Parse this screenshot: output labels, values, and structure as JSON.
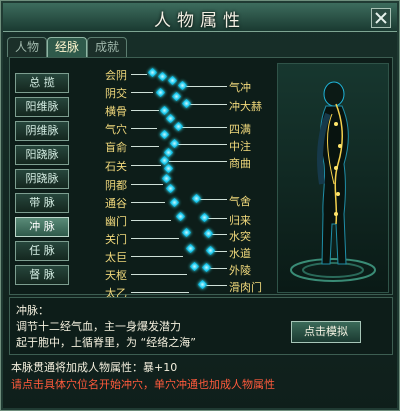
{
  "window": {
    "title": "人物属性"
  },
  "tabs": [
    {
      "label": "人物"
    },
    {
      "label": "经脉"
    },
    {
      "label": "成就"
    }
  ],
  "meridians": [
    {
      "label": "总 揽"
    },
    {
      "label": "阳维脉"
    },
    {
      "label": "阴维脉"
    },
    {
      "label": "阳跷脉"
    },
    {
      "label": "阴跷脉"
    },
    {
      "label": "带 脉"
    },
    {
      "label": "冲 脉"
    },
    {
      "label": "任 脉"
    },
    {
      "label": "督 脉"
    }
  ],
  "acupoints": {
    "left": [
      "会阴",
      "阴交",
      "横骨",
      "气穴",
      "盲俞",
      "石关",
      "阴都",
      "通谷",
      "幽门",
      "关门",
      "太巨",
      "天枢",
      "太乙"
    ],
    "right": [
      "气冲",
      "冲大赫",
      "四满",
      "中注",
      "商曲",
      "气舍",
      "归来",
      "水突",
      "水道",
      "外陵",
      "滑肉门"
    ]
  },
  "description": {
    "title": "冲脉：",
    "line1": "调节十二经气血，主一身爆发潜力",
    "line2": "起于胞中，上循脊里，为 “经络之海”"
  },
  "simulate_button": "点击模拟",
  "effect_text": "本脉贯通将加成人物属性：暴+10",
  "hint_text": "请点击具体穴位名开始冲穴，单穴冲通也加成人物属性"
}
